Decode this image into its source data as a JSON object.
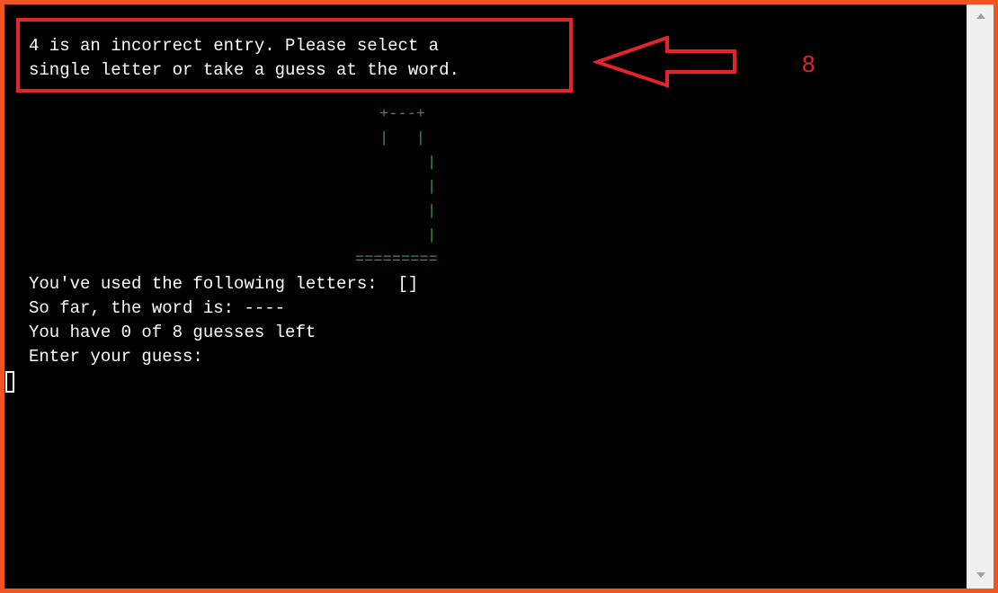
{
  "terminal": {
    "error_line_1": "4 is an incorrect entry. Please select a",
    "error_line_2": "single letter or take a guess at the word.",
    "used_letters_line": "You've used the following letters:  []",
    "word_so_far_line": "So far, the word is: ----",
    "guesses_left_line": "You have 0 of 8 guesses left",
    "prompt_line": "Enter your guess:"
  },
  "hangman": {
    "top_beam": "+---+",
    "rope_row": "|   |",
    "pole_row": "|",
    "base": "========="
  },
  "annotation": {
    "step_number": "8",
    "color": "#e4232b"
  },
  "colors": {
    "frame_border": "#ee5522",
    "terminal_bg": "#000000",
    "terminal_text": "#ffffff",
    "hangman_text": "#3f8f3f"
  },
  "icons": {
    "scroll_up": "triangle-up-icon",
    "scroll_down": "triangle-down-icon"
  }
}
